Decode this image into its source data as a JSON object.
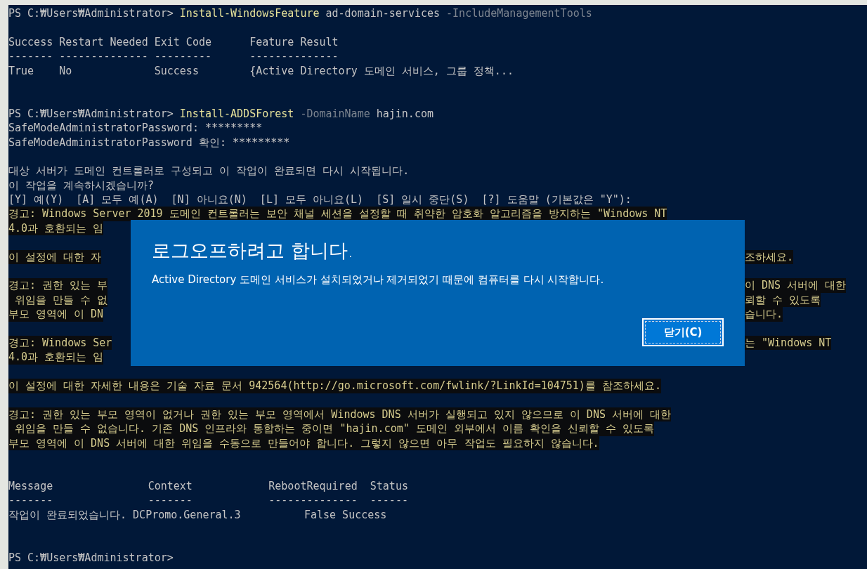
{
  "console": {
    "lines": [
      {
        "kind": "command",
        "prompt": "PS C:₩Users₩Administrator>",
        "command": "Install-WindowsFeature",
        "args": [
          {
            "kind": "value",
            "text": "ad-domain-services"
          },
          {
            "kind": "param",
            "text": "-IncludeManagementTools"
          }
        ]
      },
      {
        "kind": "blank"
      },
      {
        "kind": "output",
        "text": "Success Restart Needed Exit Code      Feature Result"
      },
      {
        "kind": "output",
        "text": "------- -------------- ---------      --------------"
      },
      {
        "kind": "output",
        "text": "True    No             Success        {Active Directory 도메인 서비스, 그룹 정책..."
      },
      {
        "kind": "blank"
      },
      {
        "kind": "blank"
      },
      {
        "kind": "command",
        "prompt": "PS C:₩Users₩Administrator>",
        "command": "Install-ADDSForest",
        "args": [
          {
            "kind": "param",
            "text": "-DomainName"
          },
          {
            "kind": "value",
            "text": "hajin.com"
          }
        ]
      },
      {
        "kind": "output",
        "text": "SafeModeAdministratorPassword: *********"
      },
      {
        "kind": "output",
        "text": "SafeModeAdministratorPassword 확인: *********"
      },
      {
        "kind": "blank"
      },
      {
        "kind": "output",
        "text": "대상 서버가 도메인 컨트롤러로 구성되고 이 작업이 완료되면 다시 시작됩니다."
      },
      {
        "kind": "output",
        "text": "이 작업을 계속하시겠습니까?"
      },
      {
        "kind": "output",
        "text": "[Y] 예(Y)  [A] 모두 예(A)  [N] 아니요(N)  [L] 모두 아니요(L)  [S] 일시 중단(S)  [?] 도움말 (기본값은 \"Y\"):"
      },
      {
        "kind": "warning",
        "text": "경고: Windows Server 2019 도메인 컨트롤러는 보안 채널 세션을 설정할 때 취약한 암호화 알고리즘을 방지하는 \"Windows NT"
      },
      {
        "kind": "covered",
        "left": "4.0과 호환되는 임"
      },
      {
        "kind": "blank"
      },
      {
        "kind": "covered",
        "left": "이 설정에 대한 자",
        "right": "조하세요."
      },
      {
        "kind": "blank"
      },
      {
        "kind": "covered",
        "left": "경고: 권한 있는 부",
        "right": "이 DNS 서버에 대한"
      },
      {
        "kind": "covered",
        "left": " 위임을 만들 수 없",
        "right": "뢰할 수 있도록"
      },
      {
        "kind": "covered",
        "left": "부모 영역에 이 DN",
        "right": "습니다."
      },
      {
        "kind": "blank"
      },
      {
        "kind": "covered",
        "left": "경고: Windows Ser",
        "right": "는 \"Windows NT"
      },
      {
        "kind": "covered",
        "left": "4.0과 호환되는 임"
      },
      {
        "kind": "blank"
      },
      {
        "kind": "warning",
        "text": "이 설정에 대한 자세한 내용은 기술 자료 문서 942564(http://go.microsoft.com/fwlink/?LinkId=104751)를 참조하세요."
      },
      {
        "kind": "blank"
      },
      {
        "kind": "warning",
        "text": "경고: 권한 있는 부모 영역이 없거나 권한 있는 부모 영역에서 Windows DNS 서버가 실행되고 있지 않으므로 이 DNS 서버에 대한"
      },
      {
        "kind": "warning",
        "text": " 위임을 만들 수 없습니다. 기존 DNS 인프라와 통합하는 중이면 \"hajin.com\" 도메인 외부에서 이름 확인을 신뢰할 수 있도록"
      },
      {
        "kind": "warning",
        "text": "부모 영역에 이 DNS 서버에 대한 위임을 수동으로 만들어야 합니다. 그렇지 않으면 아무 작업도 필요하지 않습니다."
      },
      {
        "kind": "blank"
      },
      {
        "kind": "blank"
      },
      {
        "kind": "output",
        "text": "Message               Context            RebootRequired  Status"
      },
      {
        "kind": "output",
        "text": "-------               -------            --------------  ------"
      },
      {
        "kind": "output",
        "text": "작업이 완료되었습니다. DCPromo.General.3          False Success"
      },
      {
        "kind": "blank"
      },
      {
        "kind": "blank"
      },
      {
        "kind": "output",
        "text": "PS C:₩Users₩Administrator>"
      }
    ]
  },
  "dialog": {
    "title": "로그오프하려고 합니다.",
    "message": "Active Directory 도메인 서비스가 설치되었거나 제거되었기 때문에 컴퓨터를 다시 시작합니다.",
    "button": "닫기(C)"
  }
}
